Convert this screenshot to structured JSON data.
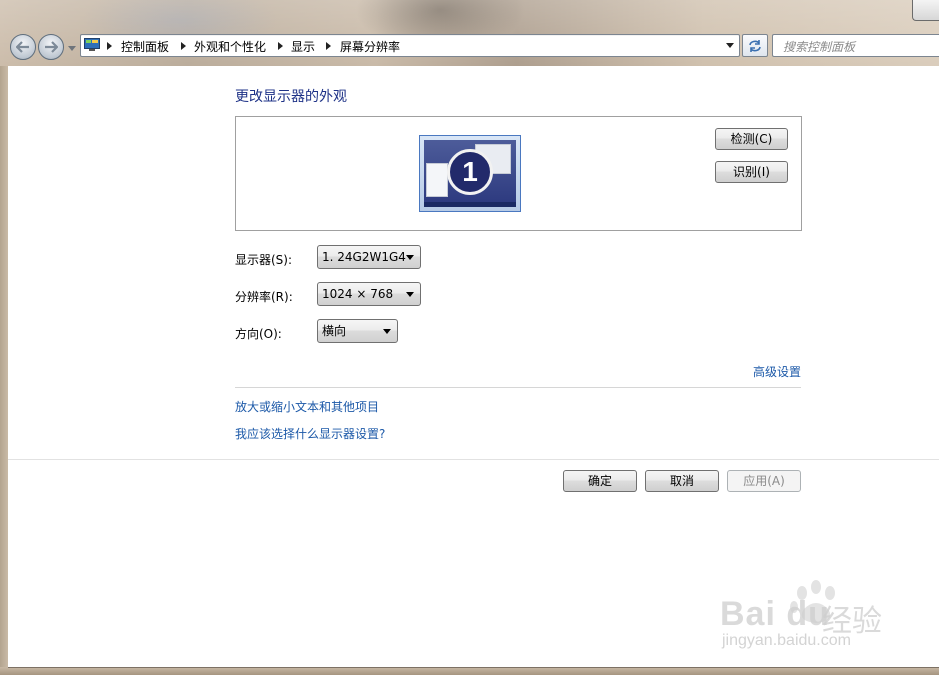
{
  "titlebar": {
    "breadcrumbs": [
      "控制面板",
      "外观和个性化",
      "显示",
      "屏幕分辨率"
    ],
    "search_placeholder": "搜索控制面板"
  },
  "main": {
    "title": "更改显示器的外观",
    "preview": {
      "monitor_number": "1",
      "detect_label": "检测(C)",
      "identify_label": "识别(I)"
    },
    "display": {
      "label": "显示器(S):",
      "value": "1. 24G2W1G4"
    },
    "resolution": {
      "label": "分辨率(R):",
      "value": "1024 × 768"
    },
    "orientation": {
      "label": "方向(O):",
      "value": "横向"
    },
    "advanced_link": "高级设置",
    "links": [
      "放大或缩小文本和其他项目",
      "我应该选择什么显示器设置?"
    ],
    "buttons": {
      "ok": "确定",
      "cancel": "取消",
      "apply": "应用(A)"
    }
  },
  "watermark": {
    "brand": "Bai du",
    "cn": "经验",
    "url": "jingyan.baidu.com"
  },
  "colors": {
    "title": "#1e3287",
    "link": "#1c59a8",
    "glass": "#c4b5a2"
  }
}
